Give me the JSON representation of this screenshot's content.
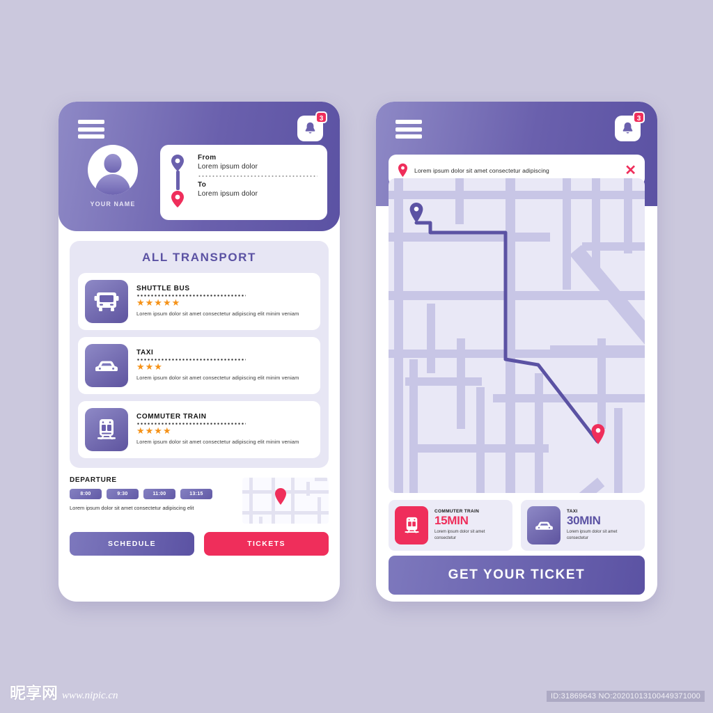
{
  "theme": {
    "bg": "#cbc8dd",
    "purple_light": "#8e89c6",
    "purple_dark": "#5b52a3",
    "pink": "#ef2e5b",
    "star": "#f59218",
    "panel": "#e7e6f4",
    "map_road": "#c8c6e6",
    "map_block": "#e9e8f6"
  },
  "left_screen": {
    "header": {
      "menu_icon": "hamburger-menu-icon",
      "bell_icon": "bell-icon",
      "notification_count": "3",
      "profile": {
        "avatar_icon": "user-avatar-icon",
        "name": "YOUR NAME"
      },
      "route": {
        "from_label": "From",
        "from_value": "Lorem ipsum dolor",
        "to_label": "To",
        "to_value": "Lorem ipsum dolor",
        "from_pin_icon": "map-pin-purple-icon",
        "to_pin_icon": "map-pin-pink-icon"
      }
    },
    "transport_panel": {
      "title": "ALL TRANSPORT",
      "items": [
        {
          "name": "SHUTTLE BUS",
          "icon": "bus-icon",
          "rating": 5,
          "stars": "★★★★★",
          "desc": "Lorem ipsum dolor sit amet consectetur adipiscing elit minim veniam"
        },
        {
          "name": "TAXI",
          "icon": "car-icon",
          "rating": 3,
          "stars": "★★★",
          "desc": "Lorem ipsum dolor sit amet consectetur adipiscing elit minim veniam"
        },
        {
          "name": "COMMUTER TRAIN",
          "icon": "train-icon",
          "rating": 4,
          "stars": "★★★★",
          "desc": "Lorem ipsum dolor sit amet consectetur adipiscing elit minim veniam"
        }
      ]
    },
    "departure": {
      "title": "DEPARTURE",
      "chips": [
        "8:00",
        "9:30",
        "11:00",
        "13:15"
      ],
      "desc": "Lorem ipsum dolor sit amet consectetur adipiscing elit",
      "minimap_pin_icon": "map-pin-pink-icon"
    },
    "buttons": {
      "schedule": "SCHEDULE",
      "tickets": "TICKETS"
    }
  },
  "right_screen": {
    "header": {
      "menu_icon": "hamburger-menu-icon",
      "bell_icon": "bell-icon",
      "notification_count": "3"
    },
    "search": {
      "pin_icon": "map-pin-pink-icon",
      "value": "Lorem ipsum dolor sit amet consectetur adipiscing",
      "clear_icon": "close-x-icon"
    },
    "map": {
      "origin_pin_icon": "map-pin-purple-icon",
      "destination_pin_icon": "map-pin-pink-icon",
      "route_color": "#5b52a3"
    },
    "eta_cards": [
      {
        "label": "COMMUTER TRAIN",
        "icon": "train-icon",
        "time": "15MIN",
        "desc": "Lorem ipsum dolor sit amet consectetur"
      },
      {
        "label": "TAXI",
        "icon": "car-icon",
        "time": "30MIN",
        "desc": "Lorem ipsum dolor sit amet consectetur"
      }
    ],
    "cta": "GET YOUR TICKET"
  },
  "watermark": {
    "brand_cn": "昵享网",
    "url": "www.nipic.cn",
    "id_text": "ID:31869643 NO:20201013100449371000"
  }
}
